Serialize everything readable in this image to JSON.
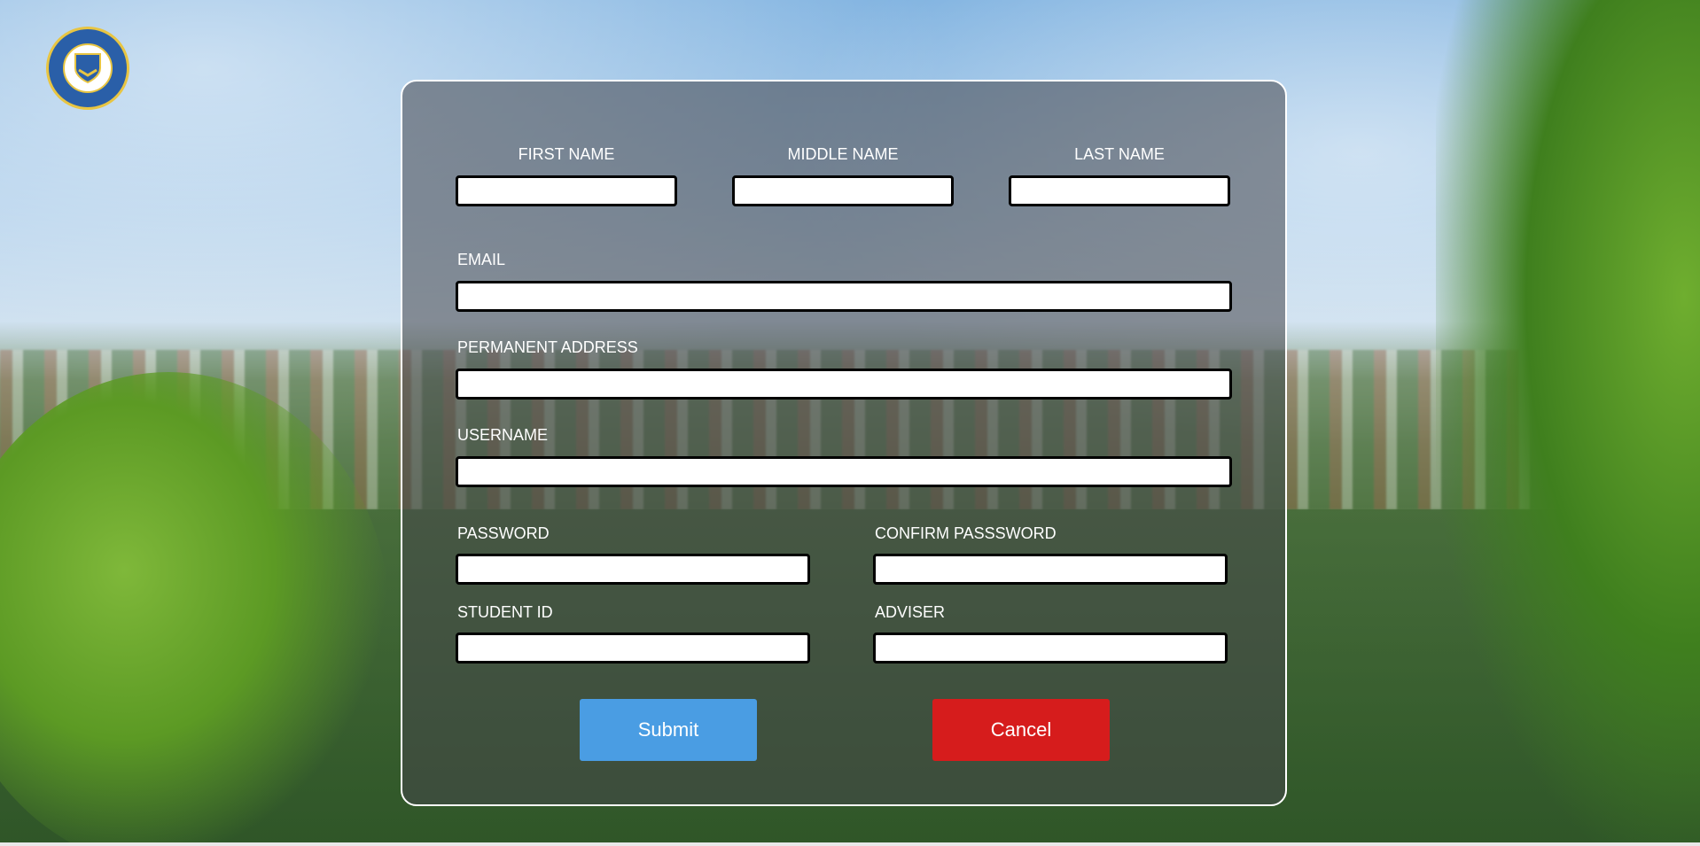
{
  "logo": {
    "icon": "university-seal-icon",
    "colors": {
      "ring": "#e8c542",
      "field": "#2a5fa8"
    }
  },
  "form": {
    "first_name": {
      "label": "FIRST NAME",
      "value": "",
      "placeholder": ""
    },
    "middle_name": {
      "label": "MIDDLE NAME",
      "value": "",
      "placeholder": ""
    },
    "last_name": {
      "label": "LAST NAME",
      "value": "",
      "placeholder": ""
    },
    "email": {
      "label": "EMAIL",
      "value": "",
      "placeholder": ""
    },
    "permanent_address": {
      "label": "PERMANENT ADDRESS",
      "value": "",
      "placeholder": ""
    },
    "username": {
      "label": "USERNAME",
      "value": "",
      "placeholder": ""
    },
    "password": {
      "label": "PASSWORD",
      "value": "",
      "placeholder": ""
    },
    "confirm_password": {
      "label": "CONFIRM PASSSWORD",
      "value": "",
      "placeholder": ""
    },
    "student_id": {
      "label": "STUDENT ID",
      "value": "",
      "placeholder": ""
    },
    "adviser": {
      "label": "ADVISER",
      "value": "",
      "placeholder": ""
    }
  },
  "buttons": {
    "submit": {
      "label": "Submit",
      "color": "#4a9de3"
    },
    "cancel": {
      "label": "Cancel",
      "color": "#d61c1c"
    }
  }
}
